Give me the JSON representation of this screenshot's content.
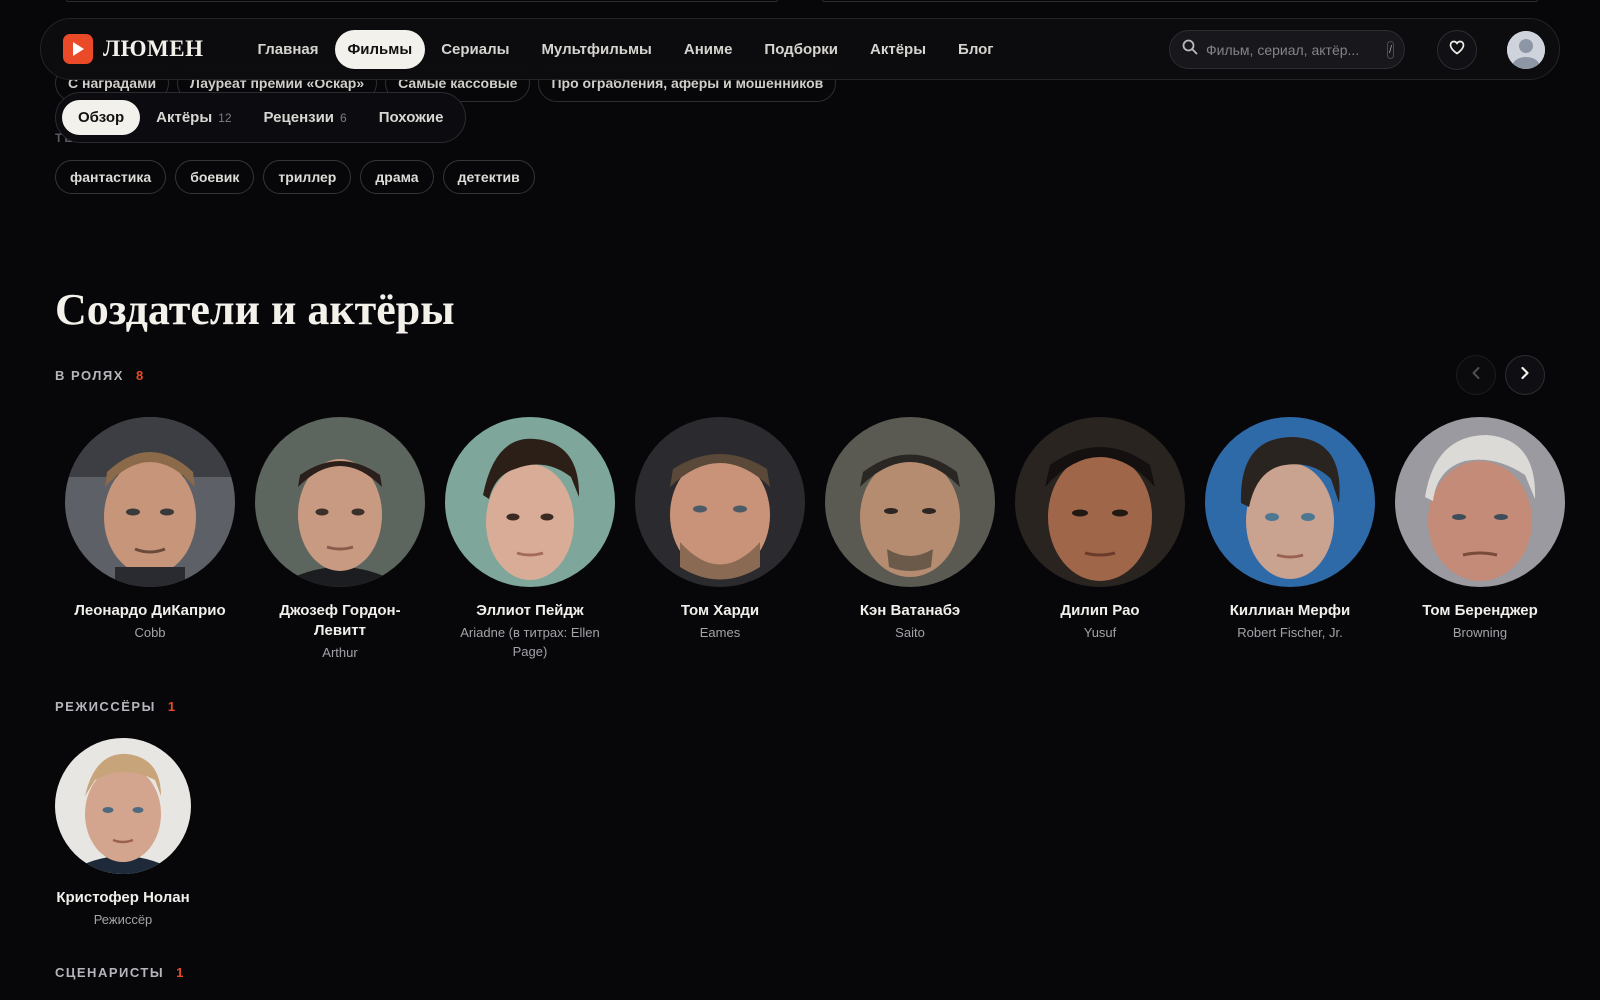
{
  "header": {
    "logo_text": "ЛЮМЕН",
    "nav": [
      {
        "label": "Главная"
      },
      {
        "label": "Фильмы",
        "active": true
      },
      {
        "label": "Сериалы"
      },
      {
        "label": "Мультфильмы"
      },
      {
        "label": "Аниме"
      },
      {
        "label": "Подборки"
      },
      {
        "label": "Актёры"
      },
      {
        "label": "Блог"
      }
    ],
    "search_placeholder": "Фильм, сериал, актёр...",
    "search_shortcut": "/"
  },
  "collections": [
    "С наградами",
    "Лауреат премии «Оскар»",
    "Самые кассовые",
    "Про ограбления, аферы и мошенников"
  ],
  "tabs": [
    {
      "label": "Обзор",
      "count": "",
      "active": true
    },
    {
      "label": "Актёры",
      "count": "12"
    },
    {
      "label": "Рецензии",
      "count": "6"
    },
    {
      "label": "Похожие",
      "count": ""
    }
  ],
  "genres_label": "ТЕГИ",
  "genres": [
    "фантастика",
    "боевик",
    "триллер",
    "драма",
    "детектив"
  ],
  "section_title": "Создатели и актёры",
  "cast": {
    "label": "В РОЛЯХ",
    "count": "8",
    "people": [
      {
        "name": "Леонардо ДиКаприо",
        "role": "Cobb"
      },
      {
        "name": "Джозеф Гордон-Левитт",
        "role": "Arthur"
      },
      {
        "name": "Эллиот Пейдж",
        "role": "Ariadne (в титрах: Ellen Page)"
      },
      {
        "name": "Том Харди",
        "role": "Eames"
      },
      {
        "name": "Кэн Ватанабэ",
        "role": "Saito"
      },
      {
        "name": "Дилип Рао",
        "role": "Yusuf"
      },
      {
        "name": "Киллиан Мерфи",
        "role": "Robert Fischer, Jr."
      },
      {
        "name": "Том Беренджер",
        "role": "Browning"
      }
    ]
  },
  "directors": {
    "label": "РЕЖИССЁРЫ",
    "count": "1",
    "people": [
      {
        "name": "Кристофер Нолан",
        "role": "Режиссёр"
      }
    ]
  },
  "writers": {
    "label": "СЦЕНАРИСТЫ",
    "count": "1"
  },
  "colors": {
    "accent": "#ea4a28",
    "background": "#07070a"
  }
}
